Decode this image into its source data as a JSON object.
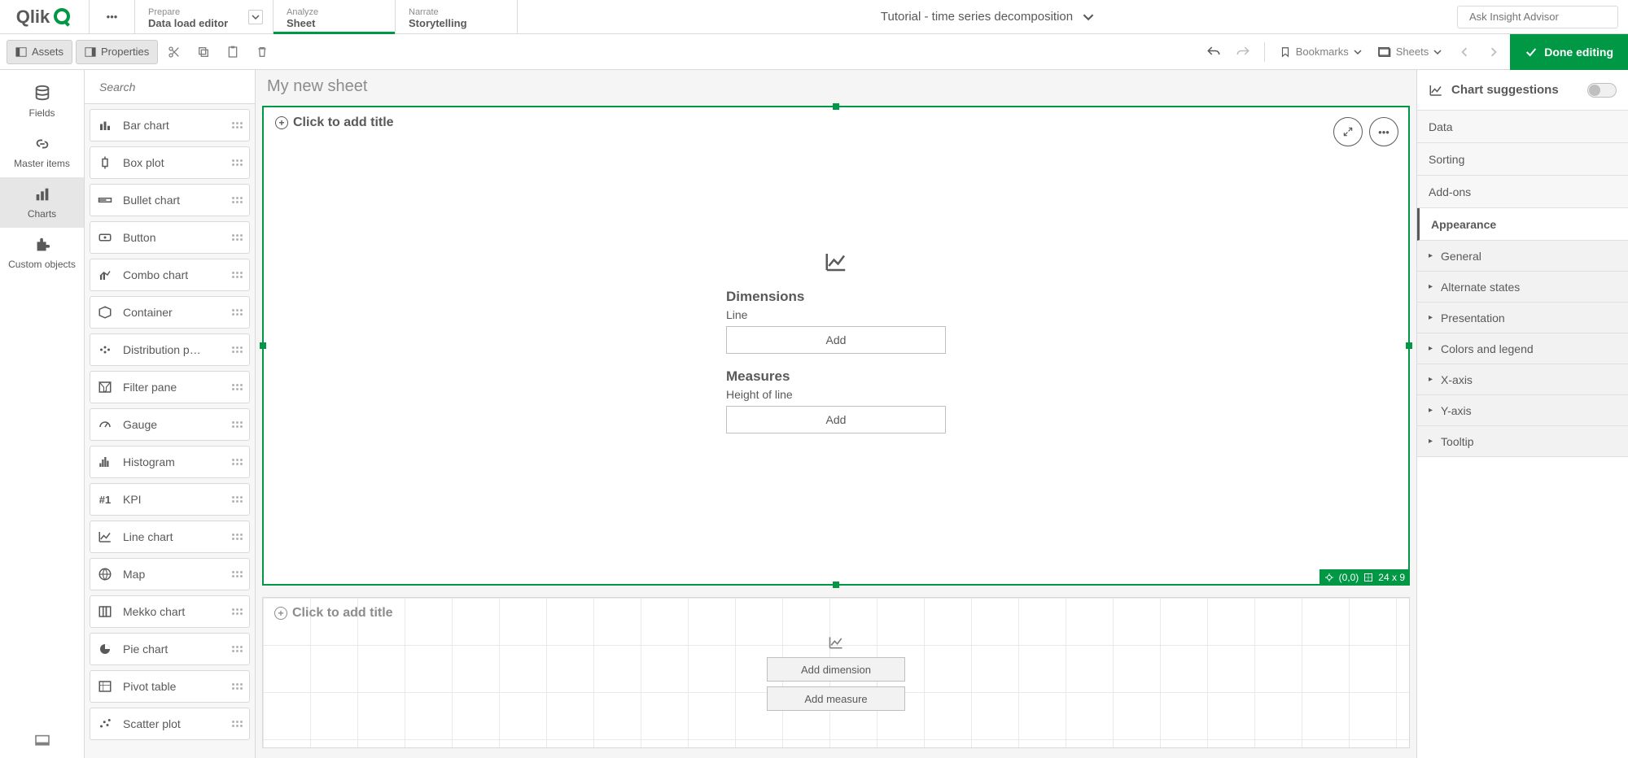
{
  "topnav": {
    "logo_text": "Qlik",
    "tabs": [
      {
        "top": "Prepare",
        "bottom": "Data load editor"
      },
      {
        "top": "Analyze",
        "bottom": "Sheet"
      },
      {
        "top": "Narrate",
        "bottom": "Storytelling"
      }
    ],
    "center_title": "Tutorial - time series decomposition",
    "search_placeholder": "Ask Insight Advisor"
  },
  "toolbar": {
    "assets_label": "Assets",
    "properties_label": "Properties",
    "bookmarks_label": "Bookmarks",
    "sheets_label": "Sheets",
    "done_label": "Done editing"
  },
  "leftrail": {
    "items": [
      {
        "label": "Fields"
      },
      {
        "label": "Master items"
      },
      {
        "label": "Charts"
      },
      {
        "label": "Custom objects"
      }
    ]
  },
  "assets": {
    "search_placeholder": "Search",
    "items": [
      "Bar chart",
      "Box plot",
      "Bullet chart",
      "Button",
      "Combo chart",
      "Container",
      "Distribution p…",
      "Filter pane",
      "Gauge",
      "Histogram",
      "KPI",
      "Line chart",
      "Map",
      "Mekko chart",
      "Pie chart",
      "Pivot table",
      "Scatter plot"
    ]
  },
  "canvas": {
    "sheet_title": "My new sheet",
    "box1": {
      "title_placeholder": "Click to add title",
      "dimensions_heading": "Dimensions",
      "dimensions_sub": "Line",
      "measures_heading": "Measures",
      "measures_sub": "Height of line",
      "add_label": "Add",
      "coords": "(0,0)",
      "size": "24 x 9"
    },
    "box2": {
      "title_placeholder": "Click to add title",
      "add_dimension": "Add dimension",
      "add_measure": "Add measure"
    }
  },
  "props": {
    "suggestions_label": "Chart suggestions",
    "sections": [
      "Data",
      "Sorting",
      "Add-ons",
      "Appearance"
    ],
    "appearance_items": [
      "General",
      "Alternate states",
      "Presentation",
      "Colors and legend",
      "X-axis",
      "Y-axis",
      "Tooltip"
    ]
  }
}
